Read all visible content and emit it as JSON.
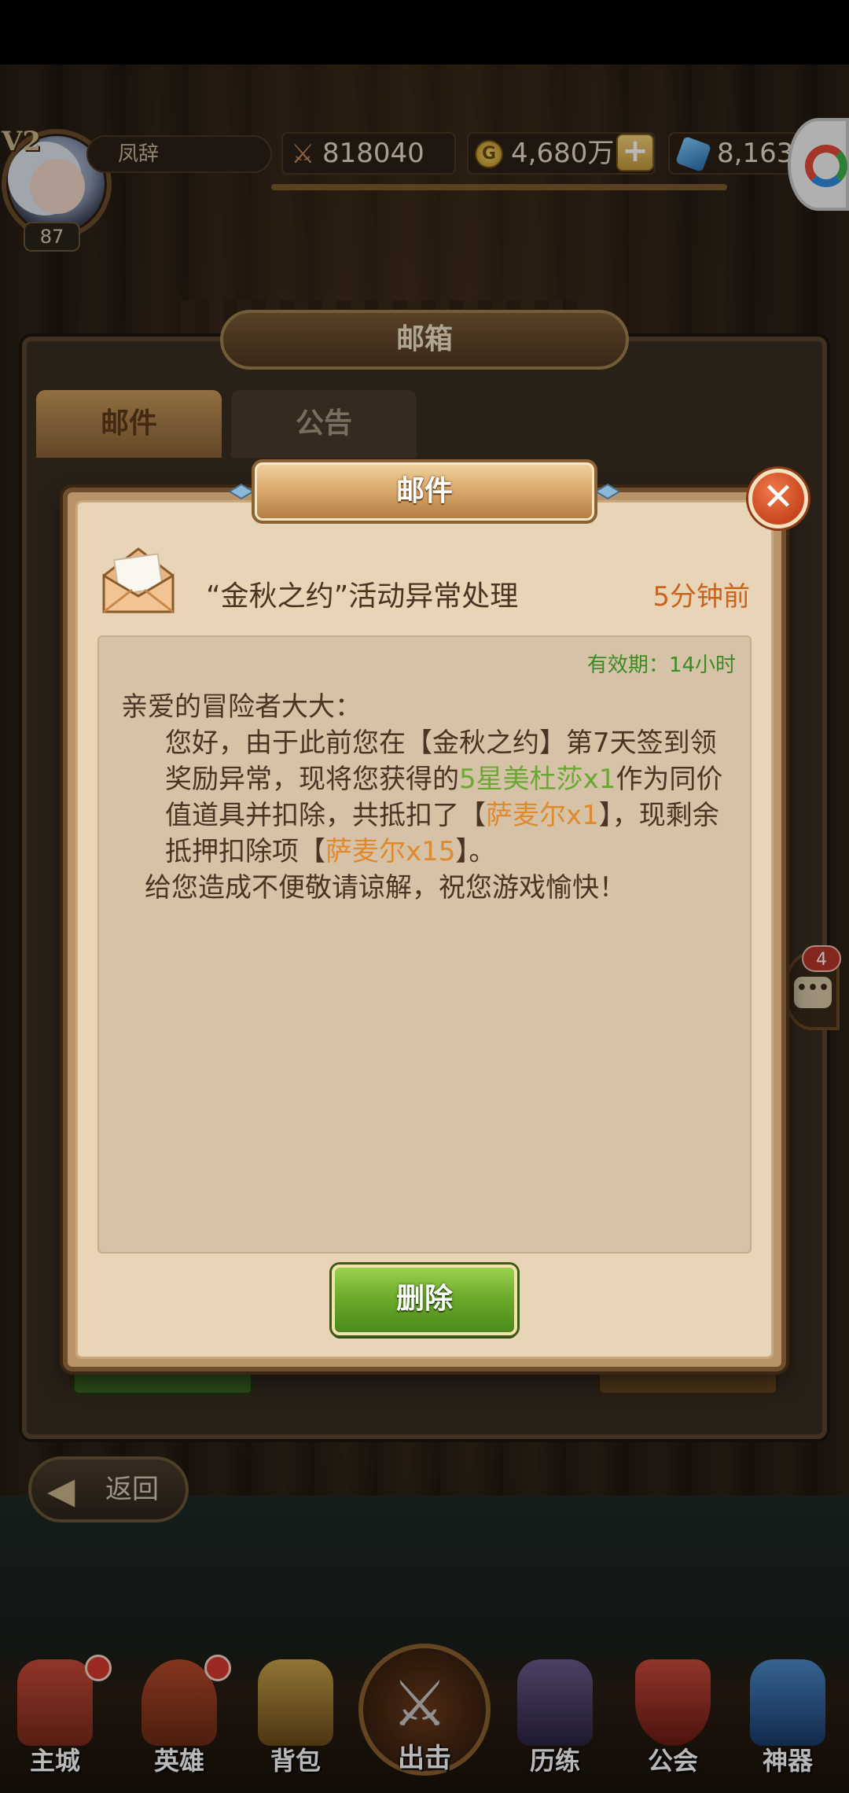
{
  "hud": {
    "vip": "V2",
    "player_name": "凤辞",
    "level": "87",
    "power": "818040",
    "gold": "4,680万",
    "gold_icon_letter": "G",
    "gems": "8,163"
  },
  "mailbox": {
    "title": "邮箱",
    "tabs": [
      "邮件",
      "公告"
    ],
    "chat_badge": "4",
    "back_label": "返回"
  },
  "dialog": {
    "title": "邮件",
    "close_symbol": "✕",
    "subject": "“金秋之约”活动异常处理",
    "time": "5分钟前",
    "validity_label": "有效期：",
    "validity_value": "14小时",
    "greeting": "亲爱的冒险者大大：",
    "body_p1_a": "您好，由于此前您在【金秋之约】第7天签到领奖励异常，现将您获得的",
    "body_p1_item": "5星美杜莎x1",
    "body_p1_b": "作为同价值道具并扣除，共抵扣了【",
    "body_p1_deducted": "萨麦尔x1",
    "body_p1_c": "】，现剩余抵押扣除项【",
    "body_p1_remaining": "萨麦尔x15",
    "body_p1_d": "】。",
    "body_p2": "给您造成不便敬请谅解，祝您游戏愉快！",
    "delete_label": "删除"
  },
  "bottom_nav": [
    {
      "label": "主城"
    },
    {
      "label": "英雄"
    },
    {
      "label": "背包"
    },
    {
      "label": "出击"
    },
    {
      "label": "历练"
    },
    {
      "label": "公会"
    },
    {
      "label": "神器"
    }
  ],
  "colors": {
    "accent_orange": "#e08a2c",
    "highlight_green": "#6aa832",
    "validity_green": "#3c8a24",
    "time_orange": "#c8641e",
    "delete_green": "#6aa82a"
  },
  "icons": [
    "power-swords-icon",
    "gold-coin-icon",
    "gem-icon",
    "plus-icon",
    "envelope-icon",
    "close-icon",
    "back-arrow-icon",
    "chat-icon"
  ]
}
